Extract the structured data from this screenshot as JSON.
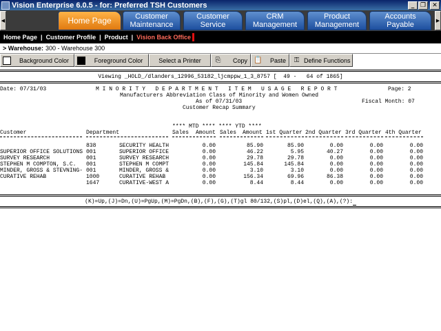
{
  "window": {
    "title": "Vision Enterprise 6.0.5 - for:  Preferred TSH Customers"
  },
  "nav": {
    "tabs": [
      {
        "l1": "Home Page",
        "l2": ""
      },
      {
        "l1": "Customer",
        "l2": "Maintenance"
      },
      {
        "l1": "Customer",
        "l2": "Service"
      },
      {
        "l1": "CRM",
        "l2": "Management"
      },
      {
        "l1": "Product",
        "l2": "Management"
      },
      {
        "l1": "Accounts",
        "l2": "Payable"
      }
    ],
    "subnav": [
      "Home Page",
      "Customer Profile",
      "Product",
      "Vision Back Office"
    ]
  },
  "warehouse": {
    "prefix": ">",
    "label": "Warehouse:",
    "value": "300 - Warehouse 300"
  },
  "toolbar": {
    "background": "Background Color",
    "foreground": "Foreground Color",
    "printer": "Select a Printer",
    "copy": "Copy",
    "paste": "Paste",
    "functions": "Define Functions"
  },
  "report": {
    "viewing": "Viewing _HOLD_/dlanders_12996_53182_ljcmppw_1_3_8757 [  49 -   64 of 1865]",
    "date": "Date: 07/31/03",
    "title": "M I N O R I T Y   D E P A R T M E N T   I T E M   U S A G E   R E P O R T",
    "page": "Page: 2",
    "subtitle": "Manufacturers Abbreviation Class of Minority and Women Owned",
    "asof": "As of 07/31/03",
    "fiscal": "Fiscal Month: 07",
    "summary": "Customer Recap Summary",
    "group_header": "**** MTD **** **** YTD ****",
    "columns": {
      "customer": "Customer",
      "department": "Department",
      "mtd_sales": "Sales",
      "mtd_amount": "Amount",
      "ytd_sales": "Sales",
      "ytd_amount": "Amount",
      "q1": "1st Quarter",
      "q2": "2nd Quarter",
      "q3": "3rd Quarter",
      "q4": "4th Quarter"
    },
    "rows": [
      {
        "customer": "",
        "dept": "838",
        "dept_name": "SECURITY HEALTH",
        "mtd": "0.00",
        "ytd": "85.90",
        "q1": "85.90",
        "q2": "0.00",
        "q3": "0.00",
        "q4": "0.00"
      },
      {
        "customer": "SUPERIOR OFFICE SOLUTIONS",
        "dept": "001",
        "dept_name": "SUPERIOR OFFICE",
        "mtd": "0.00",
        "ytd": "46.22",
        "q1": "5.95",
        "q2": "40.27",
        "q3": "0.00",
        "q4": "0.00"
      },
      {
        "customer": "SURVEY RESEARCH",
        "dept": "001",
        "dept_name": "SURVEY RESEARCH",
        "mtd": "0.00",
        "ytd": "29.78",
        "q1": "29.78",
        "q2": "0.00",
        "q3": "0.00",
        "q4": "0.00"
      },
      {
        "customer": "STEPHEN M COMPTON, S.C.",
        "dept": "001",
        "dept_name": "STEPHEN M COMPT",
        "mtd": "0.00",
        "ytd": "145.84",
        "q1": "145.84",
        "q2": "0.00",
        "q3": "0.00",
        "q4": "0.00"
      },
      {
        "customer": "MINDER, GROSS & STEVNING-",
        "dept": "001",
        "dept_name": "MINDER, GROSS &",
        "mtd": "0.00",
        "ytd": "3.10",
        "q1": "3.10",
        "q2": "0.00",
        "q3": "0.00",
        "q4": "0.00"
      },
      {
        "customer": "CURATIVE REHAB",
        "dept": "1000",
        "dept_name": "CURATIVE REHAB",
        "mtd": "0.00",
        "ytd": "156.34",
        "q1": "69.96",
        "q2": "86.38",
        "q3": "0.00",
        "q4": "0.00"
      },
      {
        "customer": "",
        "dept": "1647",
        "dept_name": "CURATIVE-WEST A",
        "mtd": "0.00",
        "ytd": "8.44",
        "q1": "8.44",
        "q2": "0.00",
        "q3": "0.00",
        "q4": "0.00"
      }
    ],
    "command": "(K)=Up,(J)=Dn,(U)=PgUp,(M)=PgDn,(B),(F),(G),(T)gl 80/132,(S)pl,(D)el,(Q),(A),(?):"
  }
}
